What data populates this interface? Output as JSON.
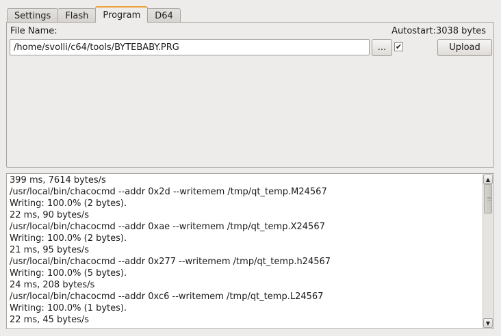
{
  "tabs": [
    {
      "label": "Settings",
      "active": false
    },
    {
      "label": "Flash",
      "active": false
    },
    {
      "label": "Program",
      "active": true
    },
    {
      "label": "D64",
      "active": false
    }
  ],
  "program": {
    "file_name_label": "File Name:",
    "file_path": "/home/svolli/c64/tools/BYTEBABY.PRG",
    "browse_label": "...",
    "autostart_checked": true,
    "autostart_mark": "✔",
    "autostart_label": "Autostart:3038 bytes",
    "upload_label": "Upload"
  },
  "log": {
    "lines": [
      "399 ms, 7614 bytes/s",
      "/usr/local/bin/chacocmd --addr 0x2d --writemem /tmp/qt_temp.M24567",
      "Writing: 100.0% (2 bytes).",
      "22 ms, 90 bytes/s",
      "/usr/local/bin/chacocmd --addr 0xae --writemem /tmp/qt_temp.X24567",
      "Writing: 100.0% (2 bytes).",
      "21 ms, 95 bytes/s",
      "/usr/local/bin/chacocmd --addr 0x277 --writemem /tmp/qt_temp.h24567",
      "Writing: 100.0% (5 bytes).",
      "24 ms, 208 bytes/s",
      "/usr/local/bin/chacocmd --addr 0xc6 --writemem /tmp/qt_temp.L24567",
      "Writing: 100.0% (1 bytes).",
      "22 ms, 45 bytes/s"
    ],
    "scroll_position": 0.0,
    "scroll_visible_fraction": 0.22
  },
  "icons": {
    "scroll_up": "▲",
    "scroll_down": "▼"
  },
  "colors": {
    "active_tab_accent": "#f0a23a",
    "window_bg": "#edeceb"
  }
}
